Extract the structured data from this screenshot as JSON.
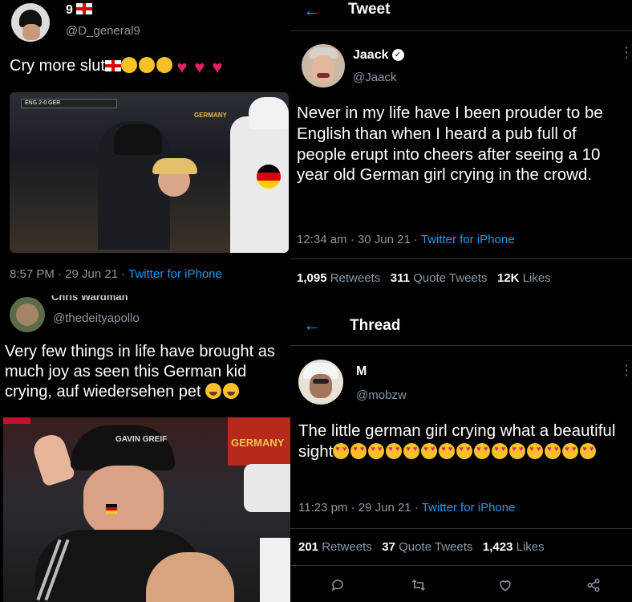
{
  "tweet1": {
    "name": "9",
    "handle": "@D_general9",
    "text": "Cry more slut",
    "time": "8:57 PM · 29 Jun 21 · ",
    "client": "Twitter for iPhone"
  },
  "tweet2": {
    "header_title": "Tweet",
    "name": "Jaack",
    "handle": "@Jaack",
    "text": "Never in my life have I been prouder to be English than when I heard a pub full of people erupt into cheers after seeing a 10 year old German girl crying in the crowd.",
    "time": "12:34 am · 30 Jun 21 · ",
    "client": "Twitter for iPhone",
    "retweets_count": "1,095",
    "retweets_label": "Retweets",
    "quotes_count": "311",
    "quotes_label": "Quote Tweets",
    "likes_count": "12K",
    "likes_label": "Likes"
  },
  "tweet3": {
    "name": "Chris Wardman",
    "handle": "@thedeityapollo",
    "text": "Very few things in life have brought as much joy as seen this German kid crying, auf wiedersehen pet"
  },
  "tweet4": {
    "header_title": "Thread",
    "name": "M",
    "handle": "@mobzw",
    "text": "The little german girl crying what a beautiful sight",
    "time": "11:23 pm · 29 Jun 21 · ",
    "client": "Twitter for iPhone",
    "retweets_count": "201",
    "retweets_label": "Retweets",
    "quotes_count": "37",
    "quotes_label": "Quote Tweets",
    "likes_count": "1,423",
    "likes_label": "Likes"
  },
  "photo1": {
    "scoreboard": "ENG 2-0 GER",
    "shirt_text": "GERMANY"
  },
  "photo3": {
    "cap_text": "GAVIN GREIF",
    "scarf_text": "GERMANY"
  },
  "colors": {
    "link": "#1d9bf0",
    "muted": "#8b98a5",
    "bg": "#000000"
  },
  "icons": [
    "back-arrow-icon",
    "more-icon",
    "verified-icon",
    "reply-icon",
    "retweet-icon",
    "like-icon",
    "share-icon"
  ]
}
